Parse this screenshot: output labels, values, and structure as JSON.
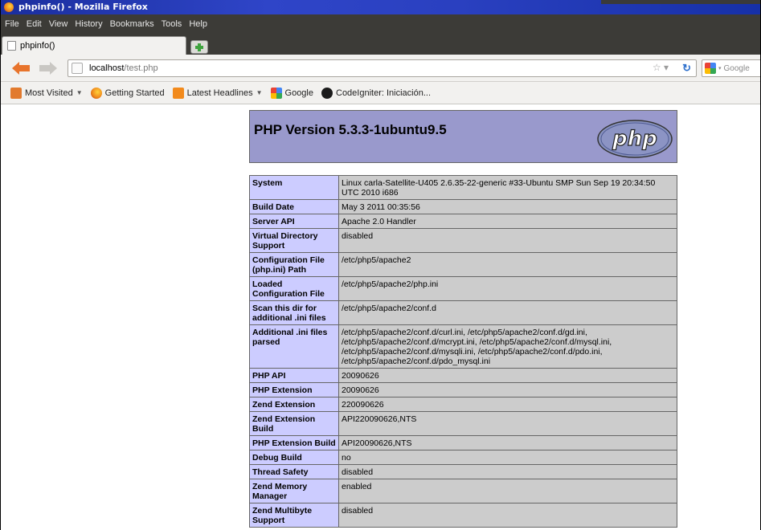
{
  "window": {
    "title": "phpinfo() - Mozilla Firefox"
  },
  "menu": {
    "items": [
      "File",
      "Edit",
      "View",
      "History",
      "Bookmarks",
      "Tools",
      "Help"
    ]
  },
  "tab": {
    "title": "phpinfo()"
  },
  "nav": {
    "url_host": "localhost",
    "url_path": "/test.php",
    "search_placeholder": "Google"
  },
  "bookmarks": [
    {
      "label": "Most Visited",
      "icon": "folder-icon",
      "dropdown": true
    },
    {
      "label": "Getting Started",
      "icon": "firefox-icon",
      "dropdown": false
    },
    {
      "label": "Latest Headlines",
      "icon": "rss-icon",
      "dropdown": true
    },
    {
      "label": "Google",
      "icon": "google-icon",
      "dropdown": false
    },
    {
      "label": "CodeIgniter: Iniciación...",
      "icon": "wordpress-icon",
      "dropdown": false
    }
  ],
  "php": {
    "version_title": "PHP Version 5.3.3-1ubuntu9.5",
    "logo_text": "php",
    "rows": [
      {
        "key": "System",
        "value": "Linux carla-Satellite-U405 2.6.35-22-generic #33-Ubuntu SMP Sun Sep 19 20:34:50 UTC 2010 i686"
      },
      {
        "key": "Build Date",
        "value": "May 3 2011 00:35:56"
      },
      {
        "key": "Server API",
        "value": "Apache 2.0 Handler"
      },
      {
        "key": "Virtual Directory Support",
        "value": "disabled"
      },
      {
        "key": "Configuration File (php.ini) Path",
        "value": "/etc/php5/apache2"
      },
      {
        "key": "Loaded Configuration File",
        "value": "/etc/php5/apache2/php.ini"
      },
      {
        "key": "Scan this dir for additional .ini files",
        "value": "/etc/php5/apache2/conf.d"
      },
      {
        "key": "Additional .ini files parsed",
        "value": "/etc/php5/apache2/conf.d/curl.ini, /etc/php5/apache2/conf.d/gd.ini, /etc/php5/apache2/conf.d/mcrypt.ini, /etc/php5/apache2/conf.d/mysql.ini, /etc/php5/apache2/conf.d/mysqli.ini, /etc/php5/apache2/conf.d/pdo.ini, /etc/php5/apache2/conf.d/pdo_mysql.ini"
      },
      {
        "key": "PHP API",
        "value": "20090626"
      },
      {
        "key": "PHP Extension",
        "value": "20090626"
      },
      {
        "key": "Zend Extension",
        "value": "220090626"
      },
      {
        "key": "Zend Extension Build",
        "value": "API220090626,NTS"
      },
      {
        "key": "PHP Extension Build",
        "value": "API20090626,NTS"
      },
      {
        "key": "Debug Build",
        "value": "no"
      },
      {
        "key": "Thread Safety",
        "value": "disabled"
      },
      {
        "key": "Zend Memory Manager",
        "value": "enabled"
      },
      {
        "key": "Zend Multibyte Support",
        "value": "disabled"
      }
    ]
  },
  "colors": {
    "header_bg": "#9999cc",
    "key_bg": "#ccccff",
    "value_bg": "#cccccc"
  }
}
